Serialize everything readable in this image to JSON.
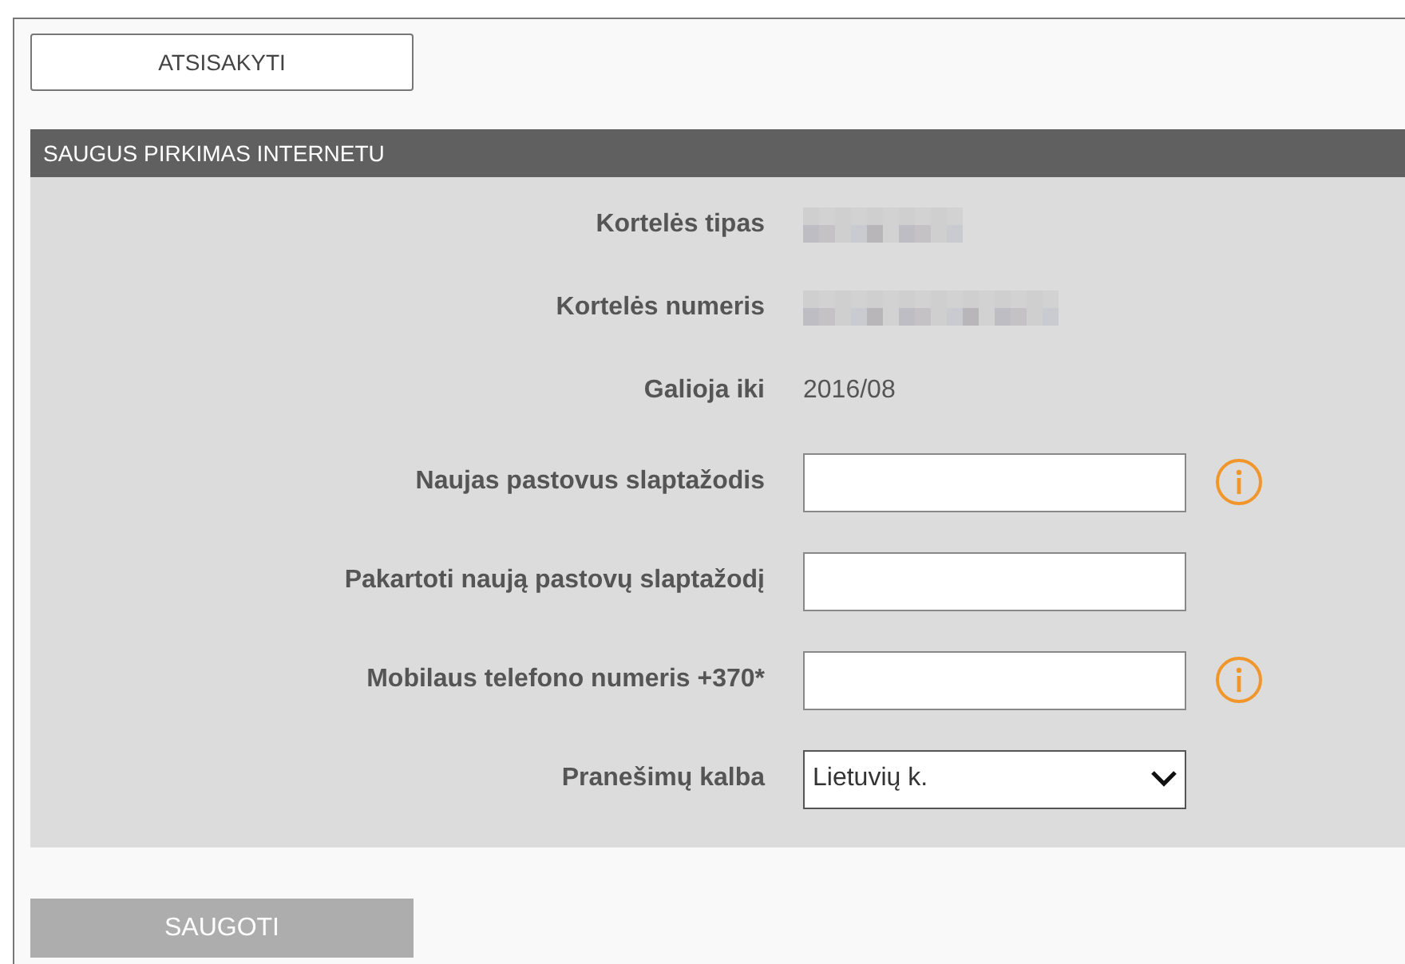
{
  "cancel_button": "ATSISAKYTI",
  "section_title": "SAUGUS PIRKIMAS INTERNETU",
  "rows": [
    {
      "kind": "masked",
      "label": "Kortelės tipas"
    },
    {
      "kind": "masked",
      "label": "Kortelės numeris"
    },
    {
      "kind": "text",
      "label": "Galioja iki",
      "value": "2016/08"
    },
    {
      "kind": "input",
      "label": "Naujas pastovus slaptažodis",
      "info": true
    },
    {
      "kind": "input",
      "label": "Pakartoti naują pastovų slaptažodį",
      "info": false
    },
    {
      "kind": "input",
      "label": "Mobilaus telefono numeris +370*",
      "info": true
    },
    {
      "kind": "select",
      "label": "Pranešimų kalba",
      "value": "Lietuvių k."
    }
  ],
  "save_button": "SAUGOTI"
}
